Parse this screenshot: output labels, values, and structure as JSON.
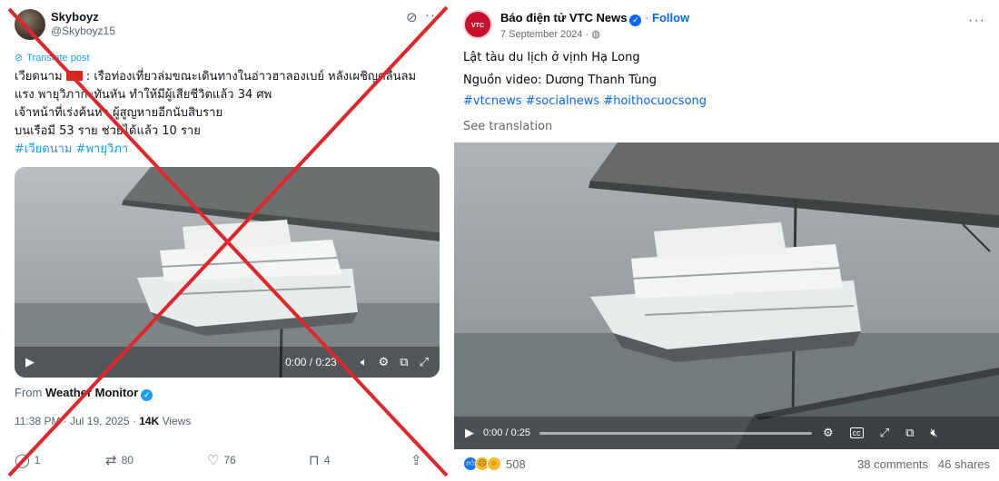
{
  "x_post": {
    "display_name": "Skyboyz",
    "handle": "@Skyboyz15",
    "translate_label": "Translate post",
    "text_line1_a": "เวียดนาม ",
    "text_line1_b": " : เรือท่องเที่ยวล่มขณะเดินทางในอ่าวฮาลองเบย์ หลังเผชิญคลื่นลม",
    "text_line2": "แรง พายุวิภากะทันหัน ทำให้มีผู้เสียชีวิตแล้ว 34 ศพ",
    "text_line3": "เจ้าหน้าที่เร่งค้นหา ผู้สูญหายอีกนับสิบราย",
    "text_line4": "บนเรือมี 53 ราย ช่วยได้แล้ว 10 ราย",
    "hashtags": "#เวียดนาม #พายุวิภา",
    "video_time": "0:00 / 0:23",
    "from_prefix": "From",
    "from_account": "Weather Monitor",
    "timestamp": "11:38 PM · Jul 19, 2025 ·",
    "views_count": "14K",
    "views_label": "Views",
    "replies": "1",
    "reposts": "80",
    "likes": "76",
    "bookmarks": "4"
  },
  "fb_post": {
    "avatar_label": "VTC NEWS",
    "page_name": "Báo điện tử VTC News",
    "follow_label": "Follow",
    "date": "7 September 2024 ·",
    "caption": "Lật tàu du lịch ở vịnh Hạ Long",
    "source": "Nguồn video: Dương Thanh Tùng",
    "hashtags": "#vtcnews #socialnews #hoithocuocsong",
    "see_translation": "See translation",
    "video_time": "0:00 / 0:25",
    "reaction_count": "508",
    "comments": "38 comments",
    "shares": "46 shares"
  },
  "icons": {
    "x_grok": "grok-icon",
    "x_more": "more-icon",
    "x_translate": "translate-icon",
    "x_play": "play-icon",
    "x_volume": "volume-icon",
    "x_settings": "settings-icon",
    "x_exit": "exit-fullscreen-icon",
    "x_expand": "expand-icon",
    "x_reply": "reply-icon",
    "x_repost": "repost-icon",
    "x_like": "heart-icon",
    "x_bookmark": "bookmark-icon",
    "x_share": "share-icon",
    "fb_settings": "settings-icon",
    "fb_captions": "captions-icon",
    "fb_expand": "expand-icon",
    "fb_pip": "picture-in-picture-icon",
    "fb_mute": "mute-icon"
  },
  "colors": {
    "x_link": "#1d9bf0",
    "fb_link": "#0866ff",
    "cross": "#e0262b"
  }
}
